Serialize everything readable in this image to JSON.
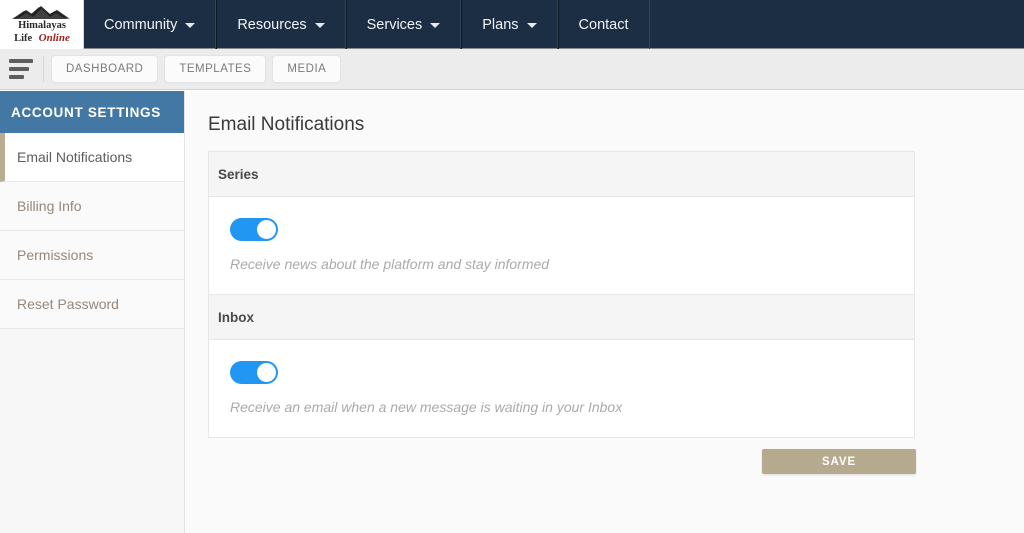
{
  "brand": {
    "name_line1": "Himalayas",
    "name_line2": "Life",
    "name_line3": "Online",
    "icon": "mountain-icon"
  },
  "topnav": {
    "background_color": "#1b2e44",
    "items": [
      {
        "label": "Community",
        "has_dropdown": true,
        "icon": "chevron-down-icon"
      },
      {
        "label": "Resources",
        "has_dropdown": true,
        "icon": "chevron-down-icon"
      },
      {
        "label": "Services",
        "has_dropdown": true,
        "icon": "chevron-down-icon"
      },
      {
        "label": "Plans",
        "has_dropdown": true,
        "icon": "chevron-down-icon"
      },
      {
        "label": "Contact",
        "has_dropdown": false,
        "icon": ""
      }
    ]
  },
  "toolbar": {
    "menu_icon": "hamburger-menu-icon",
    "background_color": "#ececec",
    "tabs": [
      {
        "label": "DASHBOARD"
      },
      {
        "label": "TEMPLATES"
      },
      {
        "label": "MEDIA"
      }
    ]
  },
  "sidebar": {
    "header": "ACCOUNT SETTINGS",
    "header_color": "#4478a4",
    "accent_color": "#b8ac93",
    "items": [
      {
        "label": "Email Notifications",
        "active": true
      },
      {
        "label": "Billing Info",
        "active": false
      },
      {
        "label": "Permissions",
        "active": false
      },
      {
        "label": "Reset Password",
        "active": false
      }
    ]
  },
  "main": {
    "title": "Email Notifications",
    "toggle_on_color": "#2196f3",
    "panels": [
      {
        "heading": "Series",
        "toggle_state": "on",
        "description": "Receive news about the platform and stay informed"
      },
      {
        "heading": "Inbox",
        "toggle_state": "on",
        "description": "Receive an email when a new message is waiting in your Inbox"
      }
    ],
    "save_label": "SAVE",
    "save_color": "#b5a98e"
  }
}
